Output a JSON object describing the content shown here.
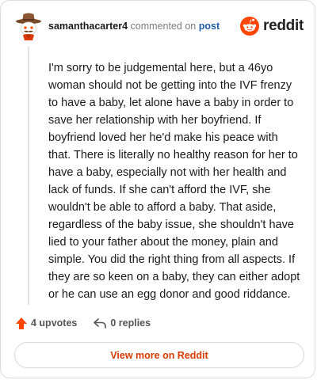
{
  "colors": {
    "reddit_orange": "#ff4500",
    "upvote_orange": "#ff4500",
    "link_blue": "#1f5fa8",
    "view_more_text": "#d93a00"
  },
  "header": {
    "username": "samanthacarter4",
    "action_text": "commented on",
    "post_link": "post",
    "brand_text": "reddit",
    "avatar_icon": "cowboy-snoo-avatar",
    "logo_icon": "reddit-snoo-logo-icon"
  },
  "comment": {
    "text": "I'm sorry to be judgemental here, but a 46yo woman should not be getting into the IVF frenzy to have a baby, let alone have a baby in order to save her relationship with her boyfriend. If boyfriend loved her he'd make his peace with that. There is literally no healthy reason for her to have a baby, especially not with her health and lack of funds. If she can't afford the IVF, she wouldn't be able to afford a baby. That aside, regardless of the baby issue, she shouldn't have lied to your father about the money, plain and simple. You did the right thing from all aspects. If they are so keen on a baby, they can either adopt or he can use an egg donor and good riddance."
  },
  "actions": {
    "upvotes_label": "4 upvotes",
    "replies_label": "0 replies",
    "upvote_icon": "upvote-arrow-icon",
    "reply_icon": "reply-arrow-icon"
  },
  "footer": {
    "view_more_label": "View more on Reddit"
  }
}
